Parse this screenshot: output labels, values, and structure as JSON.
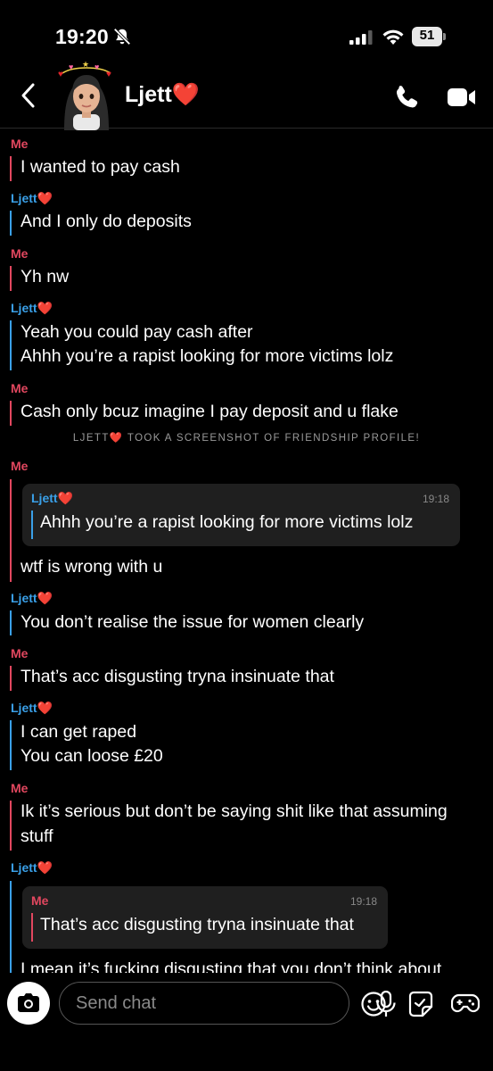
{
  "status": {
    "time": "19:20",
    "battery": "51"
  },
  "header": {
    "name": "Ljett",
    "name_emoji": "❤️"
  },
  "labels": {
    "me": "Me",
    "them": "Ljett",
    "them_emoji": "❤️"
  },
  "messages": [
    {
      "sender": "Me",
      "lines": [
        "I wanted to pay cash"
      ]
    },
    {
      "sender": "Ljett",
      "lines": [
        "And I only do deposits"
      ]
    },
    {
      "sender": "Me",
      "lines": [
        "Yh nw"
      ]
    },
    {
      "sender": "Ljett",
      "lines": [
        "Yeah you could pay cash after",
        "Ahhh you’re a rapist looking for more victims lolz"
      ]
    },
    {
      "sender": "Me",
      "lines": [
        "Cash only bcuz imagine I pay deposit and u flake"
      ]
    },
    {
      "system": "LJETT",
      "system_suffix": " TOOK A SCREENSHOT OF FRIENDSHIP PROFILE!"
    },
    {
      "sender": "Me",
      "quote": {
        "name": "Ljett",
        "time": "19:18",
        "text": "Ahhh you’re a rapist looking for more victims lolz"
      },
      "lines": [
        "wtf is wrong with u"
      ]
    },
    {
      "sender": "Ljett",
      "lines": [
        "You don’t realise the issue for women clearly"
      ]
    },
    {
      "sender": "Me",
      "lines": [
        "That’s acc disgusting tryna insinuate that"
      ]
    },
    {
      "sender": "Ljett",
      "lines": [
        "I can get raped",
        "You can loose £20"
      ]
    },
    {
      "sender": "Me",
      "lines": [
        "Ik it’s serious but don’t be saying shit like that assuming",
        "stuff"
      ]
    },
    {
      "sender": "Ljett",
      "quote": {
        "name": "Me",
        "time": "19:18",
        "text": "That’s acc disgusting tryna insinuate that"
      },
      "lines": [
        "I mean it’s fucking disgusting that you don’t think about"
      ]
    }
  ],
  "composer": {
    "placeholder": "Send chat"
  },
  "colors": {
    "me": "#e2475f",
    "them": "#3aa0e8",
    "heart": "#e3242b",
    "background": "#000000"
  },
  "icons": [
    "bell-off-icon",
    "signal-icon",
    "wifi-icon",
    "battery-icon",
    "back-chevron-icon",
    "avatar",
    "phone-icon",
    "video-icon",
    "camera-icon",
    "mic-icon",
    "emoji-icon",
    "sticker-icon",
    "game-controller-icon"
  ]
}
